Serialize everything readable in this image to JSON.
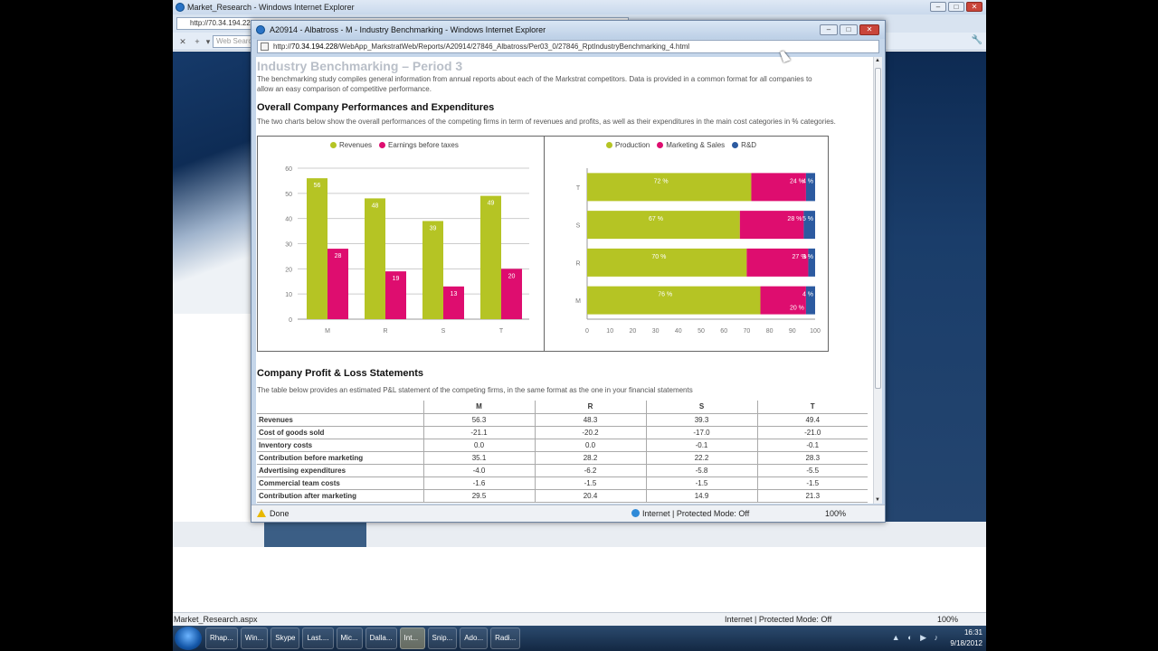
{
  "outer_browser": {
    "title": "Market_Research - Windows Internet Explorer",
    "url": "http://70.34.194.22",
    "search_placeholder": "Web Search",
    "status_left": "Market_Research.aspx",
    "status_zone": "Internet | Protected Mode: Off",
    "status_zoom": "100%"
  },
  "popup": {
    "title": "A20914 - Albatross - M - Industry Benchmarking - Windows Internet Explorer",
    "url_prefix": "http://",
    "url_host": "70.34.194.228",
    "url_path": "/WebApp_MarkstratWeb/Reports/A20914/27846_Albatross/Per03_0/27846_RptIndustryBenchmarking_4.html",
    "status_done": "Done",
    "status_zone": "Internet | Protected Mode: Off",
    "status_zoom": "100%"
  },
  "page": {
    "title": "Industry Benchmarking – Period 3",
    "intro": "The benchmarking study compiles general information from annual reports about each of the Markstrat competitors. Data is provided in a common format for all companies to allow an easy comparison of competitive performance.",
    "section1_title": "Overall Company Performances and Expenditures",
    "section1_desc": "The two charts below show the overall performances of the competing firms in term of revenues and profits, as well as their expenditures in the main cost categories in % categories.",
    "section2_title": "Company Profit & Loss Statements",
    "section2_desc": "The table below provides an estimated P&L statement of the competing firms, in the same format as the one in your financial statements"
  },
  "chart_data": [
    {
      "type": "bar",
      "categories": [
        "M",
        "R",
        "S",
        "T"
      ],
      "series": [
        {
          "name": "Revenues",
          "color": "#b5c424",
          "values": [
            56,
            48,
            39,
            49
          ]
        },
        {
          "name": "Earnings before taxes",
          "color": "#de0d6f",
          "values": [
            28,
            19,
            13,
            20
          ]
        }
      ],
      "ylim": [
        0,
        60
      ],
      "yticks": [
        0,
        10,
        20,
        30,
        40,
        50,
        60
      ],
      "grid": true,
      "legend": "top-center"
    },
    {
      "type": "bar",
      "orientation": "horizontal",
      "stacked": true,
      "categories": [
        "T",
        "S",
        "R",
        "M"
      ],
      "series": [
        {
          "name": "Production",
          "color": "#b5c424",
          "values": [
            72,
            67,
            70,
            76
          ],
          "labels": [
            "72 %",
            "67 %",
            "70 %",
            "76 %"
          ]
        },
        {
          "name": "Marketing & Sales",
          "color": "#de0d6f",
          "values": [
            24,
            28,
            27,
            20
          ],
          "labels": [
            "24 %",
            "28 %",
            "27 %",
            "20 %"
          ]
        },
        {
          "name": "R&D",
          "color": "#2c5aa0",
          "values": [
            4,
            5,
            3,
            4
          ],
          "labels": [
            "4 %",
            "5 %",
            "3 %",
            "4 %"
          ]
        }
      ],
      "xlim": [
        0,
        100
      ],
      "xticks": [
        0,
        10,
        20,
        30,
        40,
        50,
        60,
        70,
        80,
        90,
        100
      ],
      "legend": "top-center"
    }
  ],
  "pl_table": {
    "columns": [
      "M",
      "R",
      "S",
      "T"
    ],
    "rows": [
      {
        "label": "Revenues",
        "values": [
          "56.3",
          "48.3",
          "39.3",
          "49.4"
        ]
      },
      {
        "label": "Cost of goods sold",
        "values": [
          "-21.1",
          "-20.2",
          "-17.0",
          "-21.0"
        ]
      },
      {
        "label": "Inventory costs",
        "values": [
          "0.0",
          "0.0",
          "-0.1",
          "-0.1"
        ]
      },
      {
        "label": "Contribution before marketing",
        "values": [
          "35.1",
          "28.2",
          "22.2",
          "28.3"
        ]
      },
      {
        "label": "Advertising expenditures",
        "values": [
          "-4.0",
          "-6.2",
          "-5.8",
          "-5.5"
        ]
      },
      {
        "label": "Commercial team costs",
        "values": [
          "-1.6",
          "-1.5",
          "-1.5",
          "-1.5"
        ]
      },
      {
        "label": "Contribution after marketing",
        "values": [
          "29.5",
          "20.4",
          "14.9",
          "21.3"
        ]
      }
    ]
  },
  "taskbar": {
    "items": [
      "Rhap...",
      "Win...",
      "Skype",
      "Last....",
      "Mic...",
      "Dalla...",
      "Int...",
      "Snip...",
      "Ado...",
      "Radi..."
    ],
    "clock_time": "16:31",
    "clock_date": "9/18/2012"
  }
}
